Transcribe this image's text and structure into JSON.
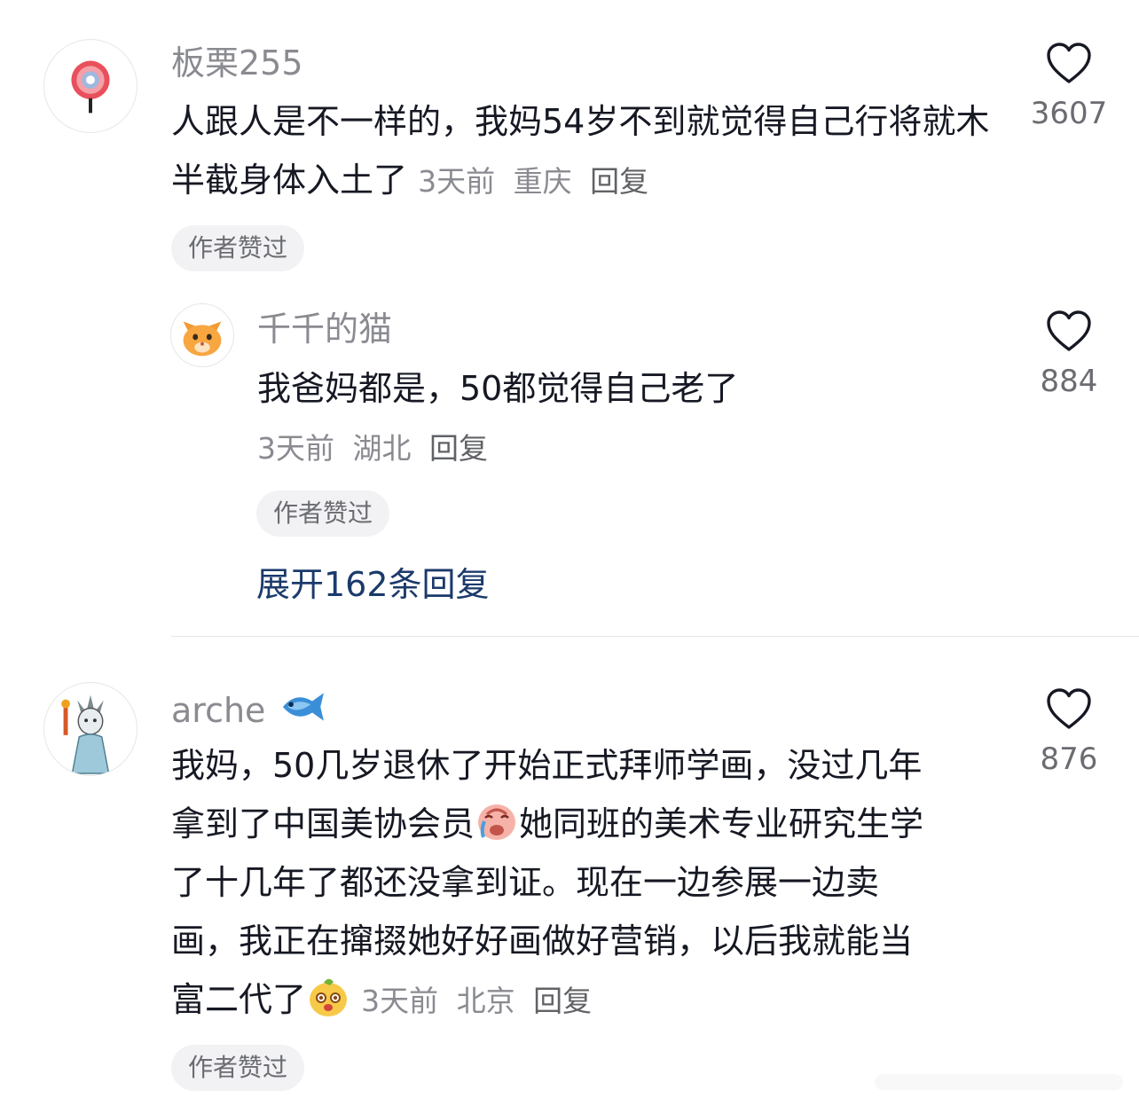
{
  "comments": [
    {
      "username": "板栗255",
      "text": "人跟人是不一样的，我妈54岁不到就觉得自己行将就木半截身体入土了",
      "time": "3天前",
      "location": "重庆",
      "reply_label": "回复",
      "badge": "作者赞过",
      "likes": "3607",
      "avatar_icon": "lollipop-avatar"
    },
    {
      "username": "千千的猫",
      "text": "我爸妈都是，50都觉得自己老了",
      "time": "3天前",
      "location": "湖北",
      "reply_label": "回复",
      "badge": "作者赞过",
      "likes": "884",
      "avatar_icon": "cat-face-avatar"
    },
    {
      "username": "arche",
      "name_emoji": "fish-icon",
      "text_line1": "我妈，50几岁退休了开始正式拜师学画，没过几年",
      "text_line2a": "拿到了中国美协会员",
      "text_emoji1": "crying-emoji",
      "text_line2b": "她同班的美术专业研究生学",
      "text_line3": "了十几年了都还没拿到证。现在一边参展一边卖",
      "text_line4": "画，我正在撺掇她好好画做好营销，以后我就能当",
      "text_line5": "富二代了",
      "text_emoji2": "happy-face-emoji",
      "time": "3天前",
      "location": "北京",
      "reply_label": "回复",
      "badge": "作者赞过",
      "likes": "876",
      "avatar_icon": "statue-of-liberty-avatar"
    }
  ],
  "expand_replies": "展开162条回复",
  "colors": {
    "secondary_text": "#8a8b91",
    "primary_text": "#161823",
    "expand_link": "#1b3a6b",
    "badge_bg": "#f2f2f4"
  }
}
